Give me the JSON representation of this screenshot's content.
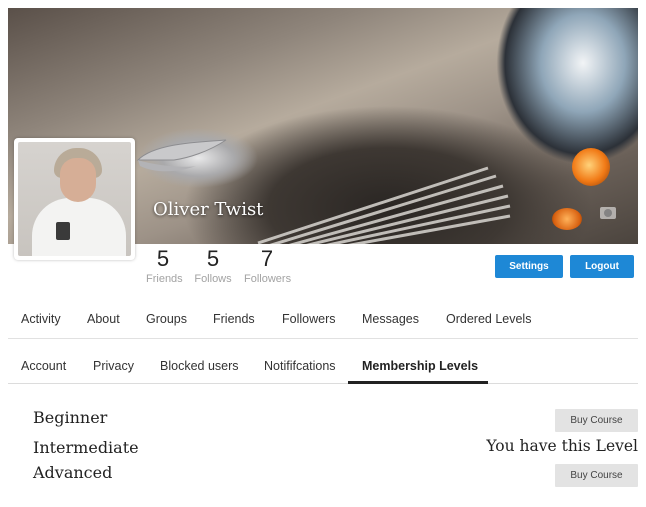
{
  "profile": {
    "name": "Oliver Twist",
    "stats": [
      {
        "value": "5",
        "label": "Friends"
      },
      {
        "value": "5",
        "label": "Follows"
      },
      {
        "value": "7",
        "label": "Followers"
      }
    ],
    "buttons": {
      "settings": "Settings",
      "logout": "Logout"
    }
  },
  "main_nav": [
    "Activity",
    "About",
    "Groups",
    "Friends",
    "Followers",
    "Messages",
    "Ordered Levels"
  ],
  "sub_nav": {
    "items": [
      "Account",
      "Privacy",
      "Blocked users",
      "Notififcations",
      "Membership Levels"
    ],
    "active": "Membership Levels"
  },
  "levels": [
    {
      "name": "Beginner",
      "action": "Buy Course"
    },
    {
      "name": "Intermediate",
      "status": "You have this Level"
    },
    {
      "name": "Advanced",
      "action": "Buy Course"
    }
  ],
  "colors": {
    "accent": "#1e88d6",
    "button_grey": "#e3e3e3"
  }
}
